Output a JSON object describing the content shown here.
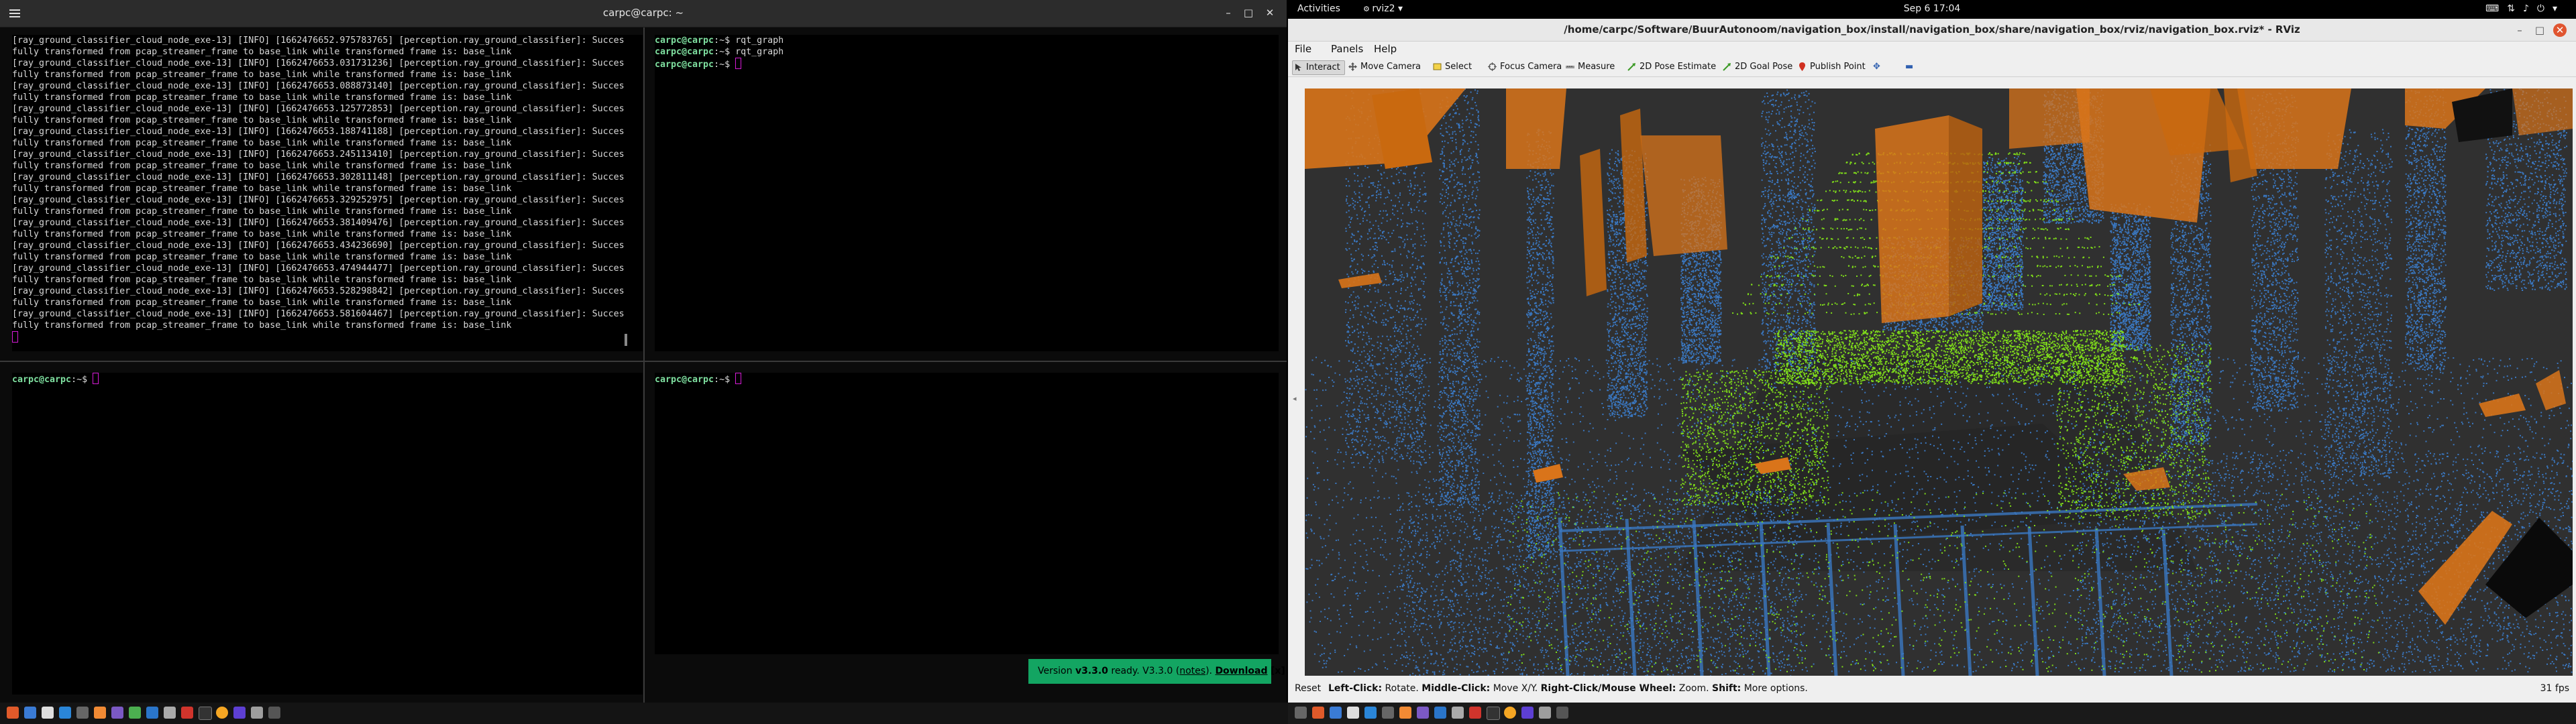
{
  "terminal": {
    "title": "carpc@carpc: ~",
    "log_lines": [
      "[ray_ground_classifier_cloud_node_exe-13] [INFO] [1662476652.975783765] [perception.ray_ground_classifier]: Succes",
      "fully transformed from pcap_streamer_frame to base_link while transformed frame is: base_link",
      "[ray_ground_classifier_cloud_node_exe-13] [INFO] [1662476653.031731236] [perception.ray_ground_classifier]: Succes",
      "fully transformed from pcap_streamer_frame to base_link while transformed frame is: base_link",
      "[ray_ground_classifier_cloud_node_exe-13] [INFO] [1662476653.088873140] [perception.ray_ground_classifier]: Succes",
      "fully transformed from pcap_streamer_frame to base_link while transformed frame is: base_link",
      "[ray_ground_classifier_cloud_node_exe-13] [INFO] [1662476653.125772853] [perception.ray_ground_classifier]: Succes",
      "fully transformed from pcap_streamer_frame to base_link while transformed frame is: base_link",
      "[ray_ground_classifier_cloud_node_exe-13] [INFO] [1662476653.188741188] [perception.ray_ground_classifier]: Succes",
      "fully transformed from pcap_streamer_frame to base_link while transformed frame is: base_link",
      "[ray_ground_classifier_cloud_node_exe-13] [INFO] [1662476653.245113410] [perception.ray_ground_classifier]: Succes",
      "fully transformed from pcap_streamer_frame to base_link while transformed frame is: base_link",
      "[ray_ground_classifier_cloud_node_exe-13] [INFO] [1662476653.302811148] [perception.ray_ground_classifier]: Succes",
      "fully transformed from pcap_streamer_frame to base_link while transformed frame is: base_link",
      "[ray_ground_classifier_cloud_node_exe-13] [INFO] [1662476653.329252975] [perception.ray_ground_classifier]: Succes",
      "fully transformed from pcap_streamer_frame to base_link while transformed frame is: base_link",
      "[ray_ground_classifier_cloud_node_exe-13] [INFO] [1662476653.381409476] [perception.ray_ground_classifier]: Succes",
      "fully transformed from pcap_streamer_frame to base_link while transformed frame is: base_link",
      "[ray_ground_classifier_cloud_node_exe-13] [INFO] [1662476653.434236690] [perception.ray_ground_classifier]: Succes",
      "fully transformed from pcap_streamer_frame to base_link while transformed frame is: base_link",
      "[ray_ground_classifier_cloud_node_exe-13] [INFO] [1662476653.474944477] [perception.ray_ground_classifier]: Succes",
      "fully transformed from pcap_streamer_frame to base_link while transformed frame is: base_link",
      "[ray_ground_classifier_cloud_node_exe-13] [INFO] [1662476653.528298842] [perception.ray_ground_classifier]: Succes",
      "fully transformed from pcap_streamer_frame to base_link while transformed frame is: base_link",
      "[ray_ground_classifier_cloud_node_exe-13] [INFO] [1662476653.581604467] [perception.ray_ground_classifier]: Succes",
      "fully transformed from pcap_streamer_frame to base_link while transformed frame is: base_link"
    ],
    "prompt": "carpc@carpc",
    "prompt_path": ":~$ ",
    "cmd_lines": [
      "rqt_graph",
      "rqt_graph"
    ],
    "notice": {
      "prefix": "Version ",
      "version": "v3.3.0",
      "mid": " ready. V3.3.0 (",
      "notes": "notes",
      "after": "). ",
      "download": "Download",
      "close": "[x]"
    }
  },
  "topbar": {
    "activities": "Activities",
    "app": "rviz2",
    "clock": "Sep 6  17:04"
  },
  "rviz": {
    "title": "/home/carpc/Software/BuurAutonoom/navigation_box/install/navigation_box/share/navigation_box/rviz/navigation_box.rviz* - RViz",
    "menu": [
      "File",
      "Panels",
      "Help"
    ],
    "tools": [
      "Interact",
      "Move Camera",
      "Select",
      "Focus Camera",
      "Measure",
      "2D Pose Estimate",
      "2D Goal Pose",
      "Publish Point"
    ],
    "status": {
      "reset": "Reset",
      "hint_parts": [
        {
          "b": "Left-Click:",
          "t": " Rotate. "
        },
        {
          "b": "Middle-Click:",
          "t": " Move X/Y. "
        },
        {
          "b": "Right-Click/Mouse Wheel:",
          "t": " Zoom. "
        },
        {
          "b": "Shift:",
          "t": " More options."
        }
      ],
      "fps": "31 fps"
    },
    "colors": {
      "ground": "#7fdc1a",
      "nonground": "#3a78c2",
      "boxes": "#e07a10",
      "background": "#303030"
    }
  }
}
